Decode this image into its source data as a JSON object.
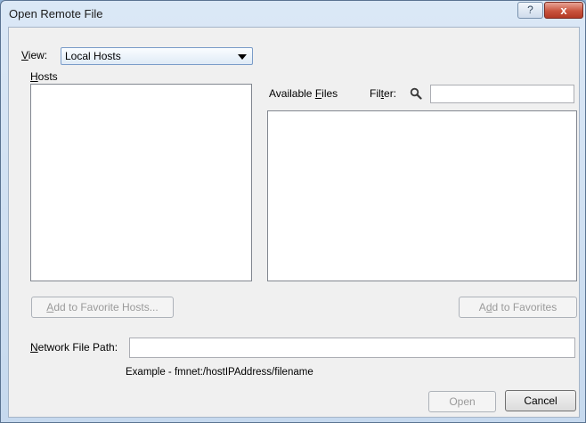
{
  "window": {
    "title": "Open Remote File",
    "help_glyph": "?",
    "close_glyph": "x"
  },
  "view": {
    "label_accel": "V",
    "label_rest": "iew:",
    "selected": "Local Hosts"
  },
  "hosts": {
    "label_accel": "H",
    "label_rest": "osts"
  },
  "available_files": {
    "label_pre": "Available ",
    "label_accel": "F",
    "label_rest": "iles"
  },
  "filter": {
    "label_pre": "Fil",
    "label_accel": "t",
    "label_rest": "er:",
    "value": ""
  },
  "buttons": {
    "add_favorite_hosts": {
      "accel": "A",
      "rest": "dd to Favorite Hosts..."
    },
    "add_to_favorites": {
      "pre": "A",
      "accel": "d",
      "rest": "d to Favorites"
    },
    "open": "Open",
    "cancel": "Cancel"
  },
  "network_path": {
    "label_accel": "N",
    "label_rest": "etwork File Path:",
    "value": ""
  },
  "example": "Example - fmnet:/hostIPAddress/filename"
}
